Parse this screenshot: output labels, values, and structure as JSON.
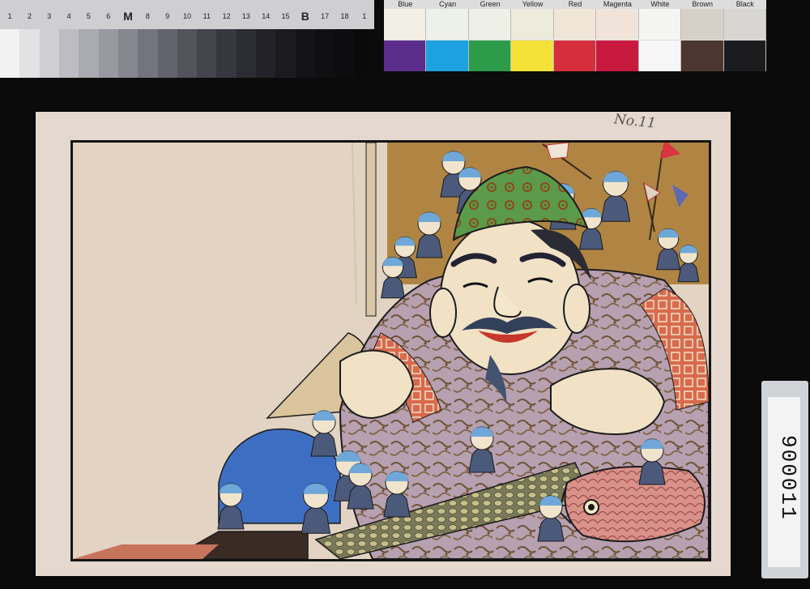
{
  "grey_scale": {
    "ticks": [
      "1",
      "2",
      "3",
      "4",
      "5",
      "6",
      "M",
      "8",
      "9",
      "10",
      "11",
      "12",
      "13",
      "14",
      "15",
      "B",
      "17",
      "18",
      "1"
    ],
    "patches": [
      "#f2f2f2",
      "#e2e2e4",
      "#cfcfd3",
      "#bcbcc2",
      "#aaaab1",
      "#9898a0",
      "#86868f",
      "#74747e",
      "#63636d",
      "#53535c",
      "#44444d",
      "#37373f",
      "#2c2c33",
      "#222228",
      "#1a1a1f",
      "#141418",
      "#101013",
      "#0d0d0f",
      "#0a0a0b"
    ]
  },
  "color_target": {
    "labels": [
      "Blue",
      "Cyan",
      "Green",
      "Yellow",
      "Red",
      "Magenta",
      "White",
      "Brown",
      "Black"
    ],
    "top_row": [
      "#f2efe6",
      "#eef0ea",
      "#eef0e7",
      "#eeeadc",
      "#f0e6d8",
      "#f0e4da",
      "#f4f4f2",
      "#d5d0c8",
      "#d8d6d2"
    ],
    "bottom_row": [
      "#5b2e8c",
      "#1ea1e0",
      "#2c9c4a",
      "#f4e238",
      "#d62e3c",
      "#c8193e",
      "#f6f6f6",
      "#4c3630",
      "#1c1c1e"
    ]
  },
  "pencil_note": "No.11",
  "accession_tag": "900011",
  "colors": {
    "gold_background": "#b08544",
    "robe": "#b7a0b0",
    "hat": "#5a9a4a",
    "sea_bream": "#d8928a"
  }
}
